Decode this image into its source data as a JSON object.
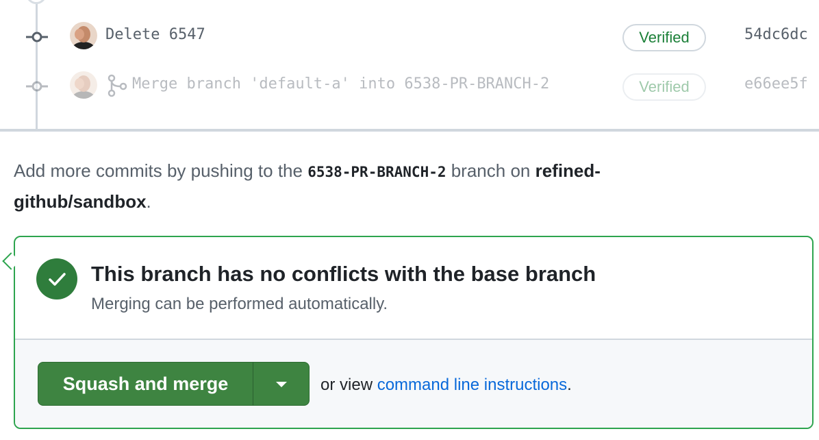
{
  "commits": [
    {
      "message": "Delete 6547",
      "badge": "Verified",
      "sha": "54dc6dc",
      "faded": false
    },
    {
      "message": "Merge branch 'default-a' into 6538-PR-BRANCH-2",
      "badge": "Verified",
      "sha": "e66ee5f",
      "faded": true
    }
  ],
  "help": {
    "prefix": "Add more commits by pushing to the ",
    "branch": "6538-PR-BRANCH-2",
    "middle": " branch on ",
    "repo_line1": "refined-",
    "repo_line2": "github/sandbox",
    "suffix": "."
  },
  "merge_box": {
    "title": "This branch has no conflicts with the base branch",
    "subtitle": "Merging can be performed automatically.",
    "merge_button": "Squash and merge",
    "cli_prefix": "or view ",
    "cli_link": "command line instructions",
    "cli_suffix": "."
  },
  "icons": {
    "commit": "git-commit-icon",
    "merge": "git-merge-icon",
    "check": "check-icon",
    "dropdown": "triangle-down-icon"
  },
  "colors": {
    "success": "#2da44e",
    "button": "#3e8441",
    "link": "#0969da",
    "verified": "#1a7f37"
  }
}
